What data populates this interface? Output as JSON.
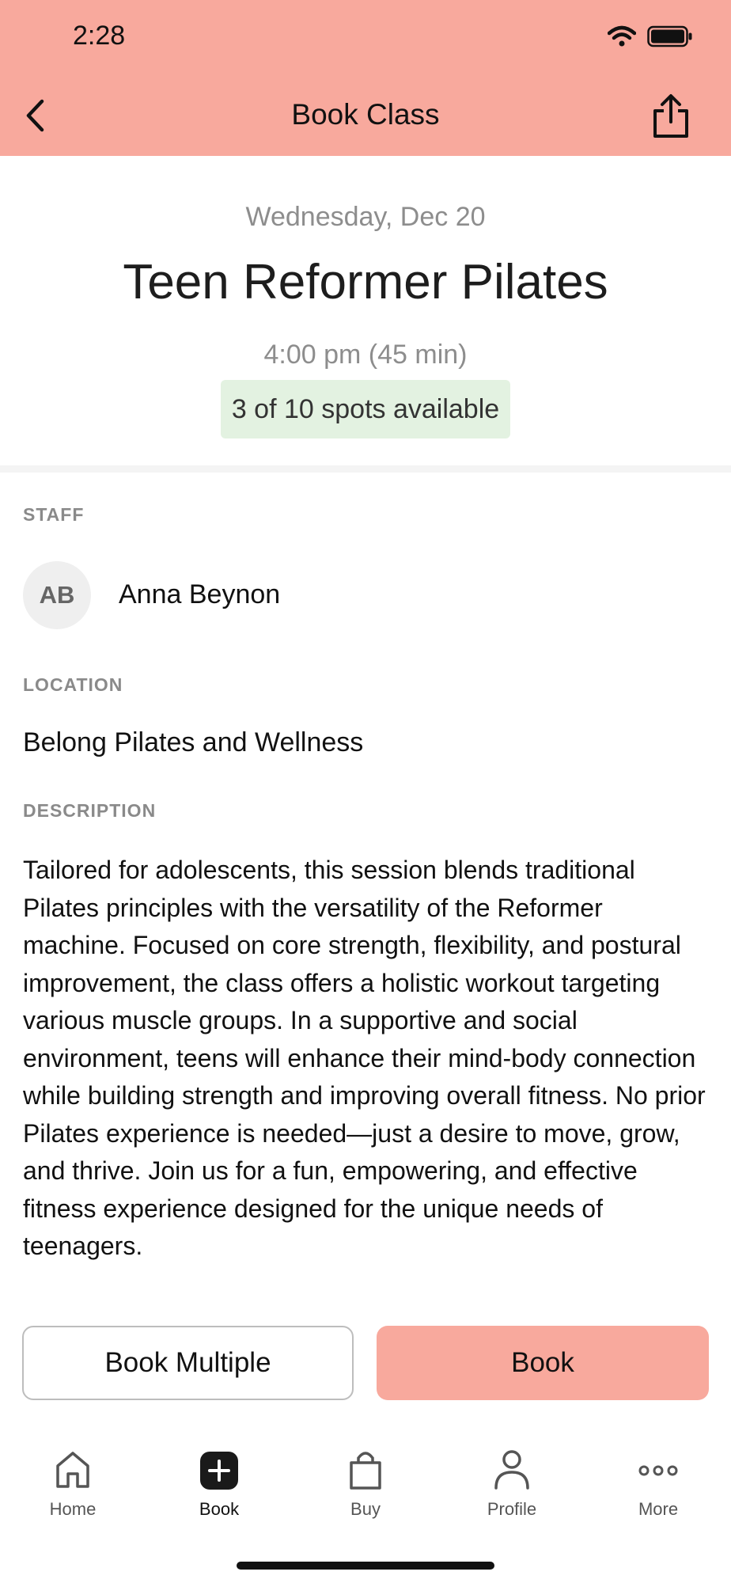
{
  "status_bar": {
    "time": "2:28"
  },
  "header": {
    "title": "Book Class"
  },
  "class": {
    "date": "Wednesday, Dec 20",
    "name": "Teen Reformer Pilates",
    "time": "4:00 pm (45 min)",
    "spots": "3 of 10 spots available"
  },
  "staff": {
    "label": "STAFF",
    "initials": "AB",
    "name": "Anna Beynon"
  },
  "location": {
    "label": "LOCATION",
    "value": "Belong Pilates and Wellness"
  },
  "description": {
    "label": "DESCRIPTION",
    "text": "Tailored for adolescents, this session blends traditional Pilates principles with the versatility of the Reformer machine. Focused on core strength, flexibility, and postural improvement, the class offers a holistic workout targeting various muscle groups. In a supportive and social environment, teens will enhance their mind-body connection while building strength and improving overall fitness. No prior Pilates experience is needed—just a desire to move, grow, and thrive. Join us for a fun, empowering, and effective fitness experience designed for the unique needs of teenagers."
  },
  "actions": {
    "book_multiple": "Book Multiple",
    "book": "Book"
  },
  "tabs": [
    {
      "label": "Home",
      "icon": "home-icon"
    },
    {
      "label": "Book",
      "icon": "plus-square-icon"
    },
    {
      "label": "Buy",
      "icon": "shopping-bag-icon"
    },
    {
      "label": "Profile",
      "icon": "person-icon"
    },
    {
      "label": "More",
      "icon": "ellipsis-icon"
    }
  ],
  "colors": {
    "accent": "#f8a99d",
    "badge_bg": "#e3f2e1",
    "muted_text": "#8d8d8d"
  }
}
